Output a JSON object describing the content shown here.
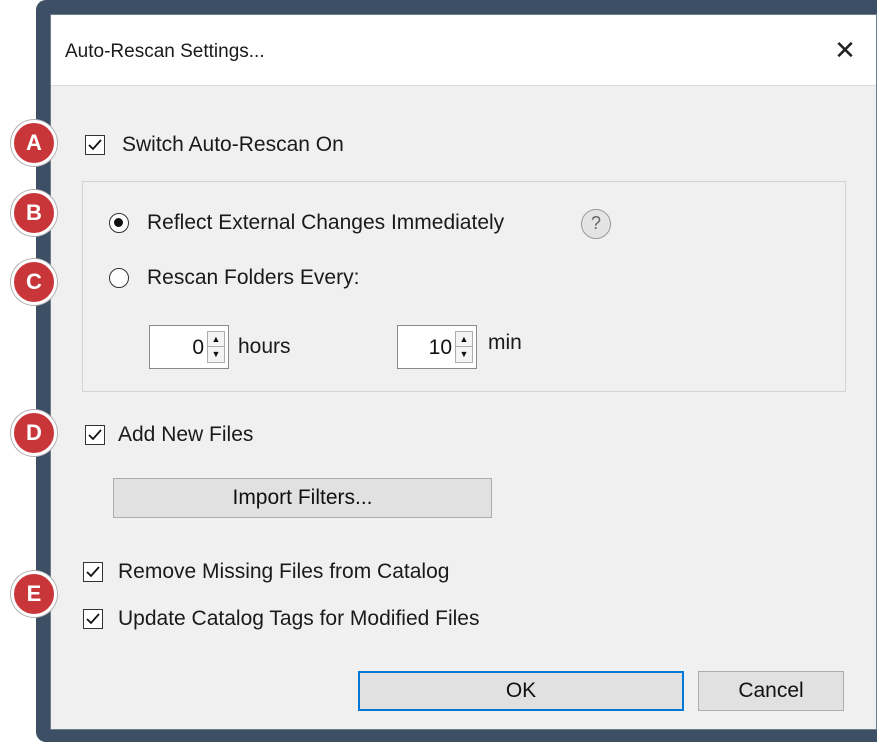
{
  "dialog": {
    "title": "Auto-Rescan Settings...",
    "close_glyph": "✕"
  },
  "options": {
    "auto_rescan": {
      "label": "Switch Auto-Rescan On",
      "checked": true
    },
    "reflect_changes": {
      "label": "Reflect External Changes  Immediately",
      "selected": true
    },
    "help_glyph": "?",
    "rescan_every": {
      "label": "Rescan Folders Every:",
      "selected": false
    },
    "hours": {
      "value": "0",
      "unit": "hours"
    },
    "minutes": {
      "value": "10",
      "unit": "min"
    },
    "add_new_files": {
      "label": "Add New Files",
      "checked": true
    },
    "import_filters_button": "Import Filters...",
    "remove_missing": {
      "label": "Remove Missing Files from Catalog",
      "checked": true
    },
    "update_tags": {
      "label": "Update Catalog Tags for Modified Files",
      "checked": true
    }
  },
  "buttons": {
    "ok": "OK",
    "cancel": "Cancel"
  },
  "badges": [
    "A",
    "B",
    "C",
    "D",
    "E"
  ],
  "colors": {
    "badge": "#c9363a",
    "default_button_border": "#0078d7",
    "frame": "#3c4f64"
  },
  "icons": {
    "checkmark": "checkmark-icon",
    "spin_up": "▲",
    "spin_down": "▼"
  }
}
